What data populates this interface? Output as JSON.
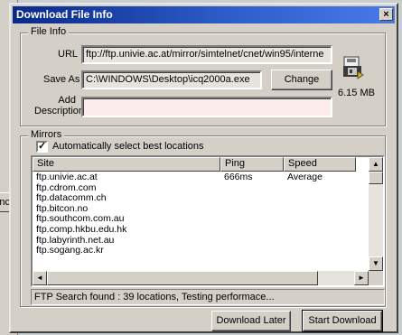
{
  "background": {
    "partial_button_label": "nc"
  },
  "dialog": {
    "title": "Download File Info",
    "close_label": "×"
  },
  "file_info": {
    "group_label": "File Info",
    "url_label": "URL",
    "url_value": "ftp://ftp.univie.ac.at/mirror/simtelnet/cnet/win95/interne",
    "save_as_label": "Save As",
    "save_as_value": "C:\\WINDOWS\\Desktop\\icq2000a.exe",
    "change_button": "Change",
    "add_description_label_line1": "Add",
    "add_description_label_line2": "Description",
    "description_value": "",
    "file_size": "6.15 MB"
  },
  "mirrors": {
    "group_label": "Mirrors",
    "auto_select_label": "Automatically select best locations",
    "auto_select_checked": true,
    "columns": [
      "Site",
      "Ping",
      "Speed"
    ],
    "rows": [
      {
        "site": "ftp.univie.ac.at",
        "ping": "666ms",
        "speed": "Average"
      },
      {
        "site": "ftp.cdrom.com",
        "ping": "",
        "speed": ""
      },
      {
        "site": "ftp.datacomm.ch",
        "ping": "",
        "speed": ""
      },
      {
        "site": "ftp.bitcon.no",
        "ping": "",
        "speed": ""
      },
      {
        "site": "ftp.southcom.com.au",
        "ping": "",
        "speed": ""
      },
      {
        "site": "ftp.comp.hkbu.edu.hk",
        "ping": "",
        "speed": ""
      },
      {
        "site": "ftp.labyrinth.net.au",
        "ping": "",
        "speed": ""
      },
      {
        "site": "ftp.sogang.ac.kr",
        "ping": "",
        "speed": ""
      }
    ]
  },
  "status": {
    "text": "FTP Search found : 39 locations, Testing performace..."
  },
  "buttons": {
    "download_later": "Download Later",
    "start_download": "Start Download"
  },
  "icons": {
    "file_icon": "floppy-disk-icon",
    "scroll_up": "▲",
    "scroll_down": "▼",
    "scroll_left": "◄",
    "scroll_right": "►"
  },
  "colors": {
    "titlebar_start": "#0a2a88",
    "titlebar_end": "#4a7ae8",
    "dialog_face": "#d4d0c8"
  }
}
